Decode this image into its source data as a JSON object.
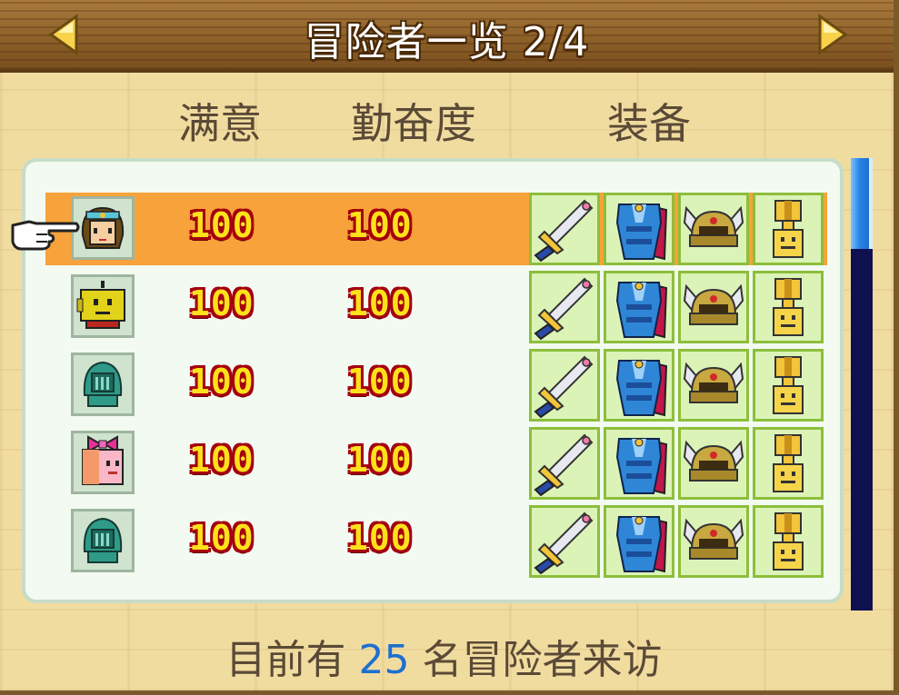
{
  "header": {
    "title": "冒险者一览 2/4",
    "prev_icon": "triangle-left-icon",
    "next_icon": "triangle-right-icon"
  },
  "columns": {
    "satisfaction": "满意",
    "diligence": "勤奋度",
    "equipment": "装备"
  },
  "rows": [
    {
      "avatar": "adventurer-girl-icon",
      "satisfaction": "100",
      "diligence": "100",
      "selected": true,
      "equipment": [
        "sword-icon",
        "armor-icon",
        "helmet-icon",
        "trophy-icon"
      ]
    },
    {
      "avatar": "yellow-robot-icon",
      "satisfaction": "100",
      "diligence": "100",
      "selected": false,
      "equipment": [
        "sword-icon",
        "armor-icon",
        "helmet-icon",
        "trophy-icon"
      ]
    },
    {
      "avatar": "teal-knight-helmet-icon",
      "satisfaction": "100",
      "diligence": "100",
      "selected": false,
      "equipment": [
        "sword-icon",
        "armor-icon",
        "helmet-icon",
        "trophy-icon"
      ]
    },
    {
      "avatar": "pink-bow-cube-icon",
      "satisfaction": "100",
      "diligence": "100",
      "selected": false,
      "equipment": [
        "sword-icon",
        "armor-icon",
        "helmet-icon",
        "trophy-icon"
      ]
    },
    {
      "avatar": "teal-knight-helmet-icon",
      "satisfaction": "100",
      "diligence": "100",
      "selected": false,
      "equipment": [
        "sword-icon",
        "armor-icon",
        "helmet-icon",
        "trophy-icon"
      ]
    }
  ],
  "footer": {
    "prefix": "目前有",
    "count": "25",
    "suffix": "名冒险者来访"
  },
  "colors": {
    "selected_row": "#f7a23a",
    "number_fill": "#ffe11a",
    "number_outline": "#a40010",
    "count_text": "#1f6fd0",
    "scroll_track": "#0e1050"
  }
}
